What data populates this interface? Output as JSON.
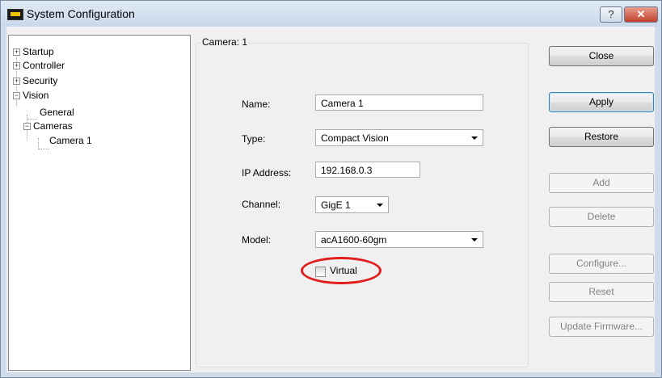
{
  "window": {
    "title": "System Configuration",
    "help_glyph": "?",
    "close_glyph": "✕"
  },
  "tree": {
    "items": [
      {
        "label": "Startup",
        "expander": "+"
      },
      {
        "label": "Controller",
        "expander": "+"
      },
      {
        "label": "Security",
        "expander": "+"
      },
      {
        "label": "Vision",
        "expander": "−"
      },
      {
        "label": "General"
      },
      {
        "label": "Cameras",
        "expander": "−"
      },
      {
        "label": "Camera 1"
      }
    ]
  },
  "panel": {
    "group_title": "Camera: 1",
    "name_label": "Name:",
    "name_value": "Camera 1",
    "type_label": "Type:",
    "type_value": "Compact Vision",
    "ip_label": "IP Address:",
    "ip_value": "192.168.0.3",
    "channel_label": "Channel:",
    "channel_value": "GigE 1",
    "model_label": "Model:",
    "model_value": "acA1600-60gm",
    "virtual_label": "Virtual",
    "virtual_checked": false,
    "highlight_color": "#e01e1e"
  },
  "buttons": {
    "close": "Close",
    "apply": "Apply",
    "restore": "Restore",
    "add": "Add",
    "delete": "Delete",
    "configure": "Configure...",
    "reset": "Reset",
    "update_firmware": "Update Firmware..."
  }
}
